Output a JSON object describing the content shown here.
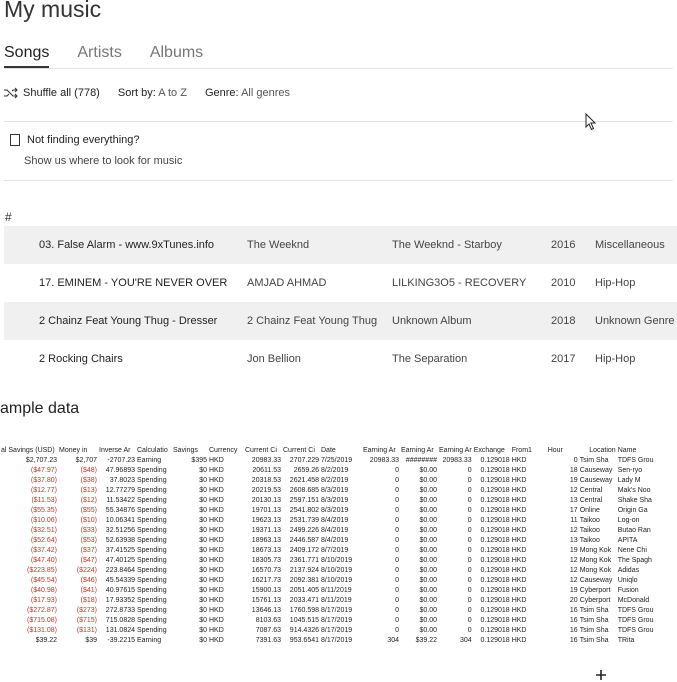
{
  "music": {
    "title": "My music",
    "tabs": [
      "Songs",
      "Artists",
      "Albums"
    ],
    "toolbar": {
      "shuffle_label": "Shuffle all (778)",
      "sort_label": "Sort by:",
      "sort_value": "A to Z",
      "genre_label": "Genre:",
      "genre_value": "All genres"
    },
    "not_finding": {
      "heading": "Not finding everything?",
      "link": "Show us where to look for music"
    },
    "index_marker": "#",
    "songs": [
      {
        "title": "03. False Alarm - www.9xTunes.info",
        "artist": "The Weeknd",
        "album": "The Weeknd - Starboy",
        "year": "2016",
        "genre": "Miscellaneous"
      },
      {
        "title": "17. EMINEM - YOU'RE NEVER OVER",
        "artist": "AMJAD AHMAD",
        "album": "LILKING3O5 - RECOVERY",
        "year": "2010",
        "genre": "Hip-Hop"
      },
      {
        "title": "2 Chainz Feat Young Thug - Dresser",
        "artist": "2 Chainz Feat Young Thug",
        "album": "Unknown Album",
        "year": "2018",
        "genre": "Unknown Genre"
      },
      {
        "title": "2 Rocking Chairs",
        "artist": "Jon Bellion",
        "album": "The Separation",
        "year": "2017",
        "genre": "Hip-Hop"
      }
    ]
  },
  "sample": {
    "title": "ample data",
    "headers": [
      "al Savings (USD)",
      "Money in",
      "Inverse Ar",
      "Calculatio",
      "Savings",
      "Currency",
      "Current Ci",
      "Current Ci",
      "Date",
      "Earning Ar",
      "Earning Ar",
      "Earning Ar",
      "Exchange",
      "From1",
      "Hour",
      "Location",
      "Name"
    ],
    "rows": [
      [
        "$2,707.23",
        "$2,707",
        "-2707.23",
        "Earning",
        "$395",
        "HKD",
        "20983.33",
        "2707.229",
        "7/25/2019",
        "20983.33",
        "########",
        "20983.33",
        "0.129018",
        "HKD",
        "",
        "0",
        "Tsim Sha",
        "TDFS Grou"
      ],
      [
        "($47.97)",
        "($48)",
        "47.96893",
        "Spending",
        "$0",
        "HKD",
        "20611.53",
        "2659.26",
        "8/2/2019",
        "0",
        "$0.00",
        "0",
        "0.129018",
        "HKD",
        "",
        "18",
        "Causeway",
        "Sen-ryo"
      ],
      [
        "($37.80)",
        "($38)",
        "37.8023",
        "Spending",
        "$0",
        "HKD",
        "20318.53",
        "2621.458",
        "8/2/2019",
        "0",
        "$0.00",
        "0",
        "0.129018",
        "HKD",
        "",
        "19",
        "Causeway",
        "Lady M"
      ],
      [
        "($12.77)",
        "($13)",
        "12.77279",
        "Spending",
        "$0",
        "HKD",
        "20219.53",
        "2608.685",
        "8/3/2019",
        "0",
        "$0.00",
        "0",
        "0.129018",
        "HKD",
        "",
        "12",
        "Central",
        "Mak's Noo"
      ],
      [
        "($11.53)",
        "($12)",
        "11.53422",
        "Spending",
        "$0",
        "HKD",
        "20130.13",
        "2597.151",
        "8/3/2019",
        "0",
        "$0.00",
        "0",
        "0.129018",
        "HKD",
        "",
        "13",
        "Central",
        "Shake Sha"
      ],
      [
        "($55.35)",
        "($55)",
        "55.34876",
        "Spending",
        "$0",
        "HKD",
        "19701.13",
        "2541.802",
        "8/3/2019",
        "0",
        "$0.00",
        "0",
        "0.129018",
        "HKD",
        "",
        "17",
        "Online",
        "Origin Ga"
      ],
      [
        "($10.06)",
        "($10)",
        "10.06341",
        "Spending",
        "$0",
        "HKD",
        "19623.13",
        "2531.739",
        "8/4/2019",
        "0",
        "$0.00",
        "0",
        "0.129018",
        "HKD",
        "",
        "11",
        "Taikoo",
        "Log-on"
      ],
      [
        "($32.51)",
        "($33)",
        "32.51256",
        "Spending",
        "$0",
        "HKD",
        "19371.13",
        "2499.226",
        "8/4/2019",
        "0",
        "$0.00",
        "0",
        "0.129018",
        "HKD",
        "",
        "12",
        "Taikoo",
        "Butao Ran"
      ],
      [
        "($52.64)",
        "($53)",
        "52.63938",
        "Spending",
        "$0",
        "HKD",
        "18963.13",
        "2446.587",
        "8/4/2019",
        "0",
        "$0.00",
        "0",
        "0.129018",
        "HKD",
        "",
        "13",
        "Taikoo",
        "APITA"
      ],
      [
        "($37.42)",
        "($37)",
        "37.41525",
        "Spending",
        "$0",
        "HKD",
        "18673.13",
        "2409.172",
        "8/7/2019",
        "0",
        "$0.00",
        "0",
        "0.129018",
        "HKD",
        "",
        "19",
        "Mong Kok",
        "Nene Chi"
      ],
      [
        "($47.40)",
        "($47)",
        "47.40125",
        "Spending",
        "$0",
        "HKD",
        "18305.73",
        "2361.771",
        "8/10/2019",
        "0",
        "$0.00",
        "0",
        "0.129018",
        "HKD",
        "",
        "12",
        "Mong Kok",
        "The Spagh"
      ],
      [
        "($223.85)",
        "($224)",
        "223.8464",
        "Spending",
        "$0",
        "HKD",
        "16570.73",
        "2137.924",
        "8/10/2019",
        "0",
        "$0.00",
        "0",
        "0.129018",
        "HKD",
        "",
        "12",
        "Mong Kok",
        "Adidas"
      ],
      [
        "($45.54)",
        "($46)",
        "45.54339",
        "Spending",
        "$0",
        "HKD",
        "16217.73",
        "2092.381",
        "8/10/2019",
        "0",
        "$0.00",
        "0",
        "0.129018",
        "HKD",
        "",
        "12",
        "Causeway",
        "Uniqlo"
      ],
      [
        "($40.98)",
        "($41)",
        "40.97615",
        "Spending",
        "$0",
        "HKD",
        "15900.13",
        "2051.405",
        "8/11/2019",
        "0",
        "$0.00",
        "0",
        "0.129018",
        "HKD",
        "",
        "19",
        "Cyberport",
        "Fusion"
      ],
      [
        "($17.93)",
        "($18)",
        "17.93352",
        "Spending",
        "$0",
        "HKD",
        "15761.13",
        "2033.471",
        "8/11/2019",
        "0",
        "$0.00",
        "0",
        "0.129018",
        "HKD",
        "",
        "20",
        "Cyberport",
        "McDonald"
      ],
      [
        "($272.87)",
        "($273)",
        "272.8733",
        "Spending",
        "$0",
        "HKD",
        "13646.13",
        "1760.598",
        "8/17/2019",
        "0",
        "$0.00",
        "0",
        "0.129018",
        "HKD",
        "",
        "16",
        "Tsim Sha",
        "TDFS Grou"
      ],
      [
        "($715.08)",
        "($715)",
        "715.0828",
        "Spending",
        "$0",
        "HKD",
        "8103.63",
        "1045.515",
        "8/17/2019",
        "0",
        "$0.00",
        "0",
        "0.129018",
        "HKD",
        "",
        "16",
        "Tsim Sha",
        "TDFS Grou"
      ],
      [
        "($131.08)",
        "($131)",
        "131.0824",
        "Spending",
        "$0",
        "HKD",
        "7087.63",
        "914.4326",
        "8/17/2019",
        "0",
        "$0.00",
        "0",
        "0.129018",
        "HKD",
        "",
        "16",
        "Tsim Sha",
        "TDFS Grou"
      ],
      [
        "$39.22",
        "$39",
        "-39.2215",
        "Earning",
        "$0",
        "HKD",
        "7391.63",
        "953.6541",
        "8/17/2019",
        "304",
        "$39.22",
        "304",
        "0.129018",
        "HKD",
        "",
        "16",
        "Tsim Sha",
        "TRita"
      ]
    ]
  }
}
